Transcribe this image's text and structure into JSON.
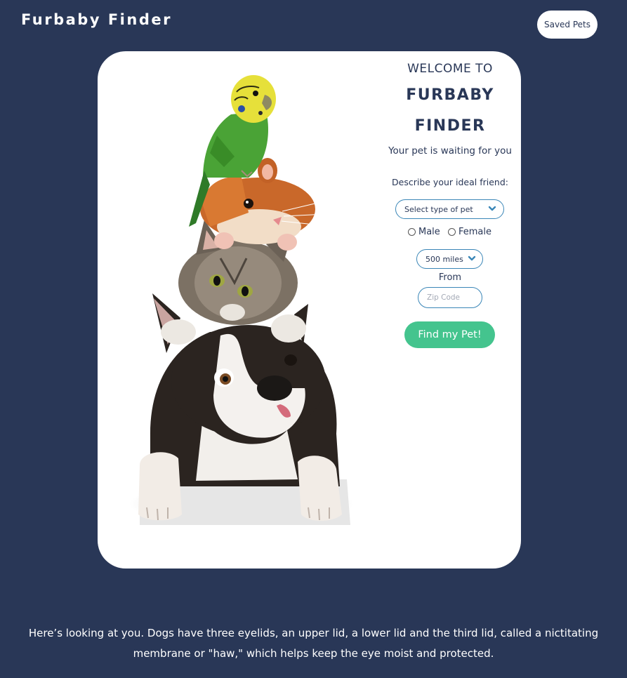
{
  "header": {
    "app_title": "Furbaby Finder",
    "saved_pets_label": "Saved Pets"
  },
  "hero": {
    "image_alt": "Stack of pets: budgie, hamster, kitten and Boston terrier"
  },
  "form": {
    "welcome": "WELCOME TO",
    "brand_line1": "FURBABY",
    "brand_line2": "FINDER",
    "tagline": "Your pet is waiting for you",
    "describe_label": "Describe your ideal friend:",
    "pet_type_selected": "Select type of pet",
    "gender_options": [
      "Male",
      "Female"
    ],
    "distance_selected": "500 miles",
    "from_label": "From",
    "zip_placeholder": "Zip Code",
    "zip_value": "",
    "submit_label": "Find my Pet!"
  },
  "footer": {
    "fact": "Here’s looking at you. Dogs have three eyelids, an upper lid, a lower lid and the third lid, called a nictitating membrane or \"haw,\" which helps keep the eye moist and protected."
  },
  "colors": {
    "background": "#293757",
    "card": "#ffffff",
    "accent_button": "#44c48e",
    "field_border": "#3a86b7",
    "text_dark": "#293757"
  },
  "icons": {
    "select_chevron": "chevron-down-icon",
    "gender_radio": "radio-button-icon"
  }
}
